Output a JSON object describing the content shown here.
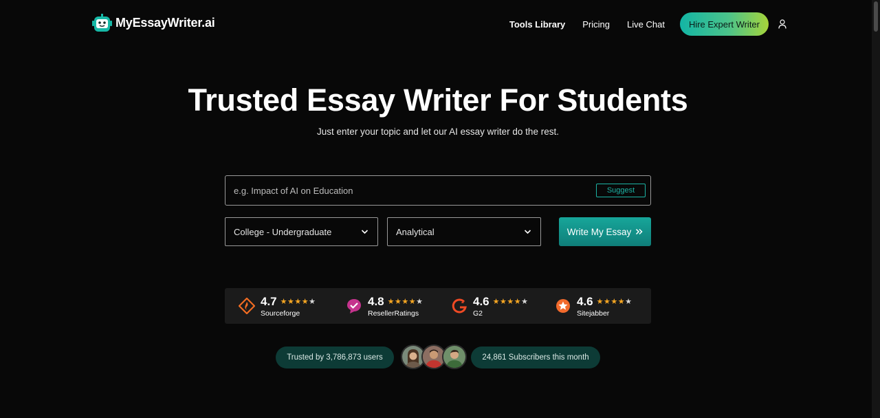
{
  "brand": {
    "name": "MyEssayWriter.ai",
    "accent": "#13b5a5"
  },
  "nav": {
    "items": [
      "Tools Library",
      "Pricing",
      "Live Chat"
    ],
    "cta_label": "Hire Expert Writer",
    "user_icon": "user-icon"
  },
  "hero": {
    "title": "Trusted Essay Writer For Students",
    "subtitle": "Just enter your topic and let our AI essay writer do the rest."
  },
  "form": {
    "topic_placeholder": "e.g. Impact of AI on Education",
    "topic_value": "",
    "suggest_label": "Suggest",
    "academic_level": "College - Undergraduate",
    "essay_type": "Analytical",
    "submit_label": "Write My Essay"
  },
  "ratings": [
    {
      "score": "4.7",
      "stars": "★★★★",
      "last_star": "★",
      "source": "Sourceforge",
      "icon": "sourceforge-icon"
    },
    {
      "score": "4.8",
      "stars": "★★★★",
      "last_star": "★",
      "source": "ResellerRatings",
      "icon": "resellerratings-icon"
    },
    {
      "score": "4.6",
      "stars": "★★★★",
      "last_star": "★",
      "source": "G2",
      "icon": "g2-icon"
    },
    {
      "score": "4.6",
      "stars": "★★★★",
      "last_star": "★",
      "source": "Sitejabber",
      "icon": "sitejabber-icon"
    }
  ],
  "trust": {
    "users_text": "Trusted by 3,786,873 users",
    "subscribers_text": "24,861 Subscribers this month"
  }
}
